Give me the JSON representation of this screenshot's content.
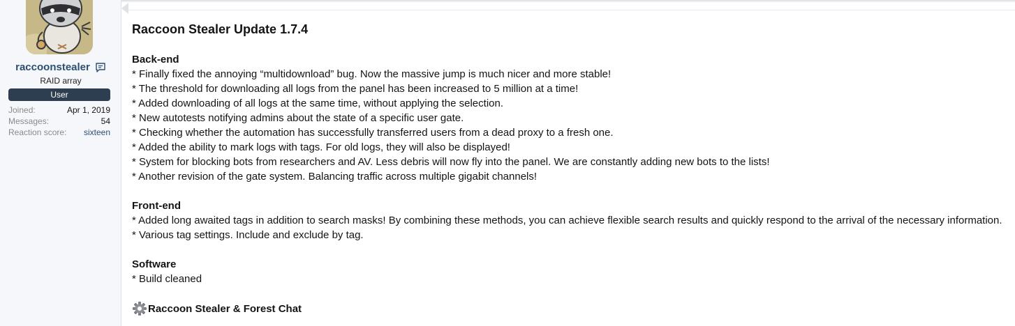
{
  "user": {
    "username": "raccoonstealer",
    "title": "RAID array",
    "banner": "User",
    "stats": [
      {
        "term": "Joined:",
        "value": "Apr 1, 2019"
      },
      {
        "term": "Messages:",
        "value": "54"
      },
      {
        "term": "Reaction score:",
        "value": "sixteen"
      }
    ]
  },
  "post": {
    "title": "Raccoon Stealer Update 1.7.4",
    "sections": [
      {
        "heading": "Back-end",
        "items": [
          "* Finally fixed the annoying “multidownload” bug. Now the massive jump is much nicer and more stable!",
          "* The threshold for downloading all logs from the panel has been increased to 5 million at a time!",
          "* Added downloading of all logs at the same time, without applying the selection.",
          "* New autotests notifying admins about the state of a specific user gate.",
          "* Checking whether the automation has successfully transferred users from a dead proxy to a fresh one.",
          "* Added the ability to mark logs with tags. For old logs, they will also be displayed!",
          "* System for blocking bots from researchers and AV. Less debris will now fly into the panel. We are constantly adding new bots to the lists!",
          "* Another revision of the gate system. Balancing traffic across multiple gigabit channels!"
        ]
      },
      {
        "heading": "Front-end",
        "items": [
          "* Added long awaited tags in addition to search masks! By combining these methods, you can achieve flexible search results and quickly respond to the arrival of the necessary information.",
          "* Various tag settings. Include and exclude by tag."
        ]
      },
      {
        "heading": "Software",
        "items": [
          "* Build cleaned"
        ]
      }
    ],
    "footer": {
      "icon": "gear-icon",
      "text": "Raccoon Stealer & Forest Chat"
    }
  },
  "colors": {
    "username": "#2b4f72",
    "banner_bg": "#2d3e50",
    "sidebar_bg": "#f5f7fa"
  }
}
